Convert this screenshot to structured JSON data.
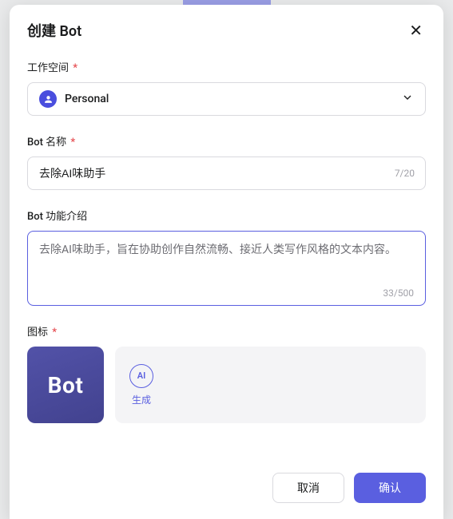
{
  "modal": {
    "title": "创建 Bot",
    "close_icon": "✕"
  },
  "fields": {
    "workspace": {
      "label": "工作空间",
      "required_mark": "*",
      "selected": "Personal"
    },
    "name": {
      "label": "Bot 名称",
      "required_mark": "*",
      "value": "去除AI味助手",
      "counter": "7/20"
    },
    "description": {
      "label": "Bot 功能介绍",
      "value": "去除AI味助手，旨在协助创作自然流畅、接近人类写作风格的文本内容。",
      "counter": "33/500"
    },
    "icon": {
      "label": "图标",
      "required_mark": "*",
      "preview_text": "Bot",
      "generate_badge": "AI",
      "generate_label": "生成"
    }
  },
  "footer": {
    "cancel": "取消",
    "confirm": "确认"
  },
  "colors": {
    "accent": "#5a5fe0",
    "required": "#e5484d"
  }
}
